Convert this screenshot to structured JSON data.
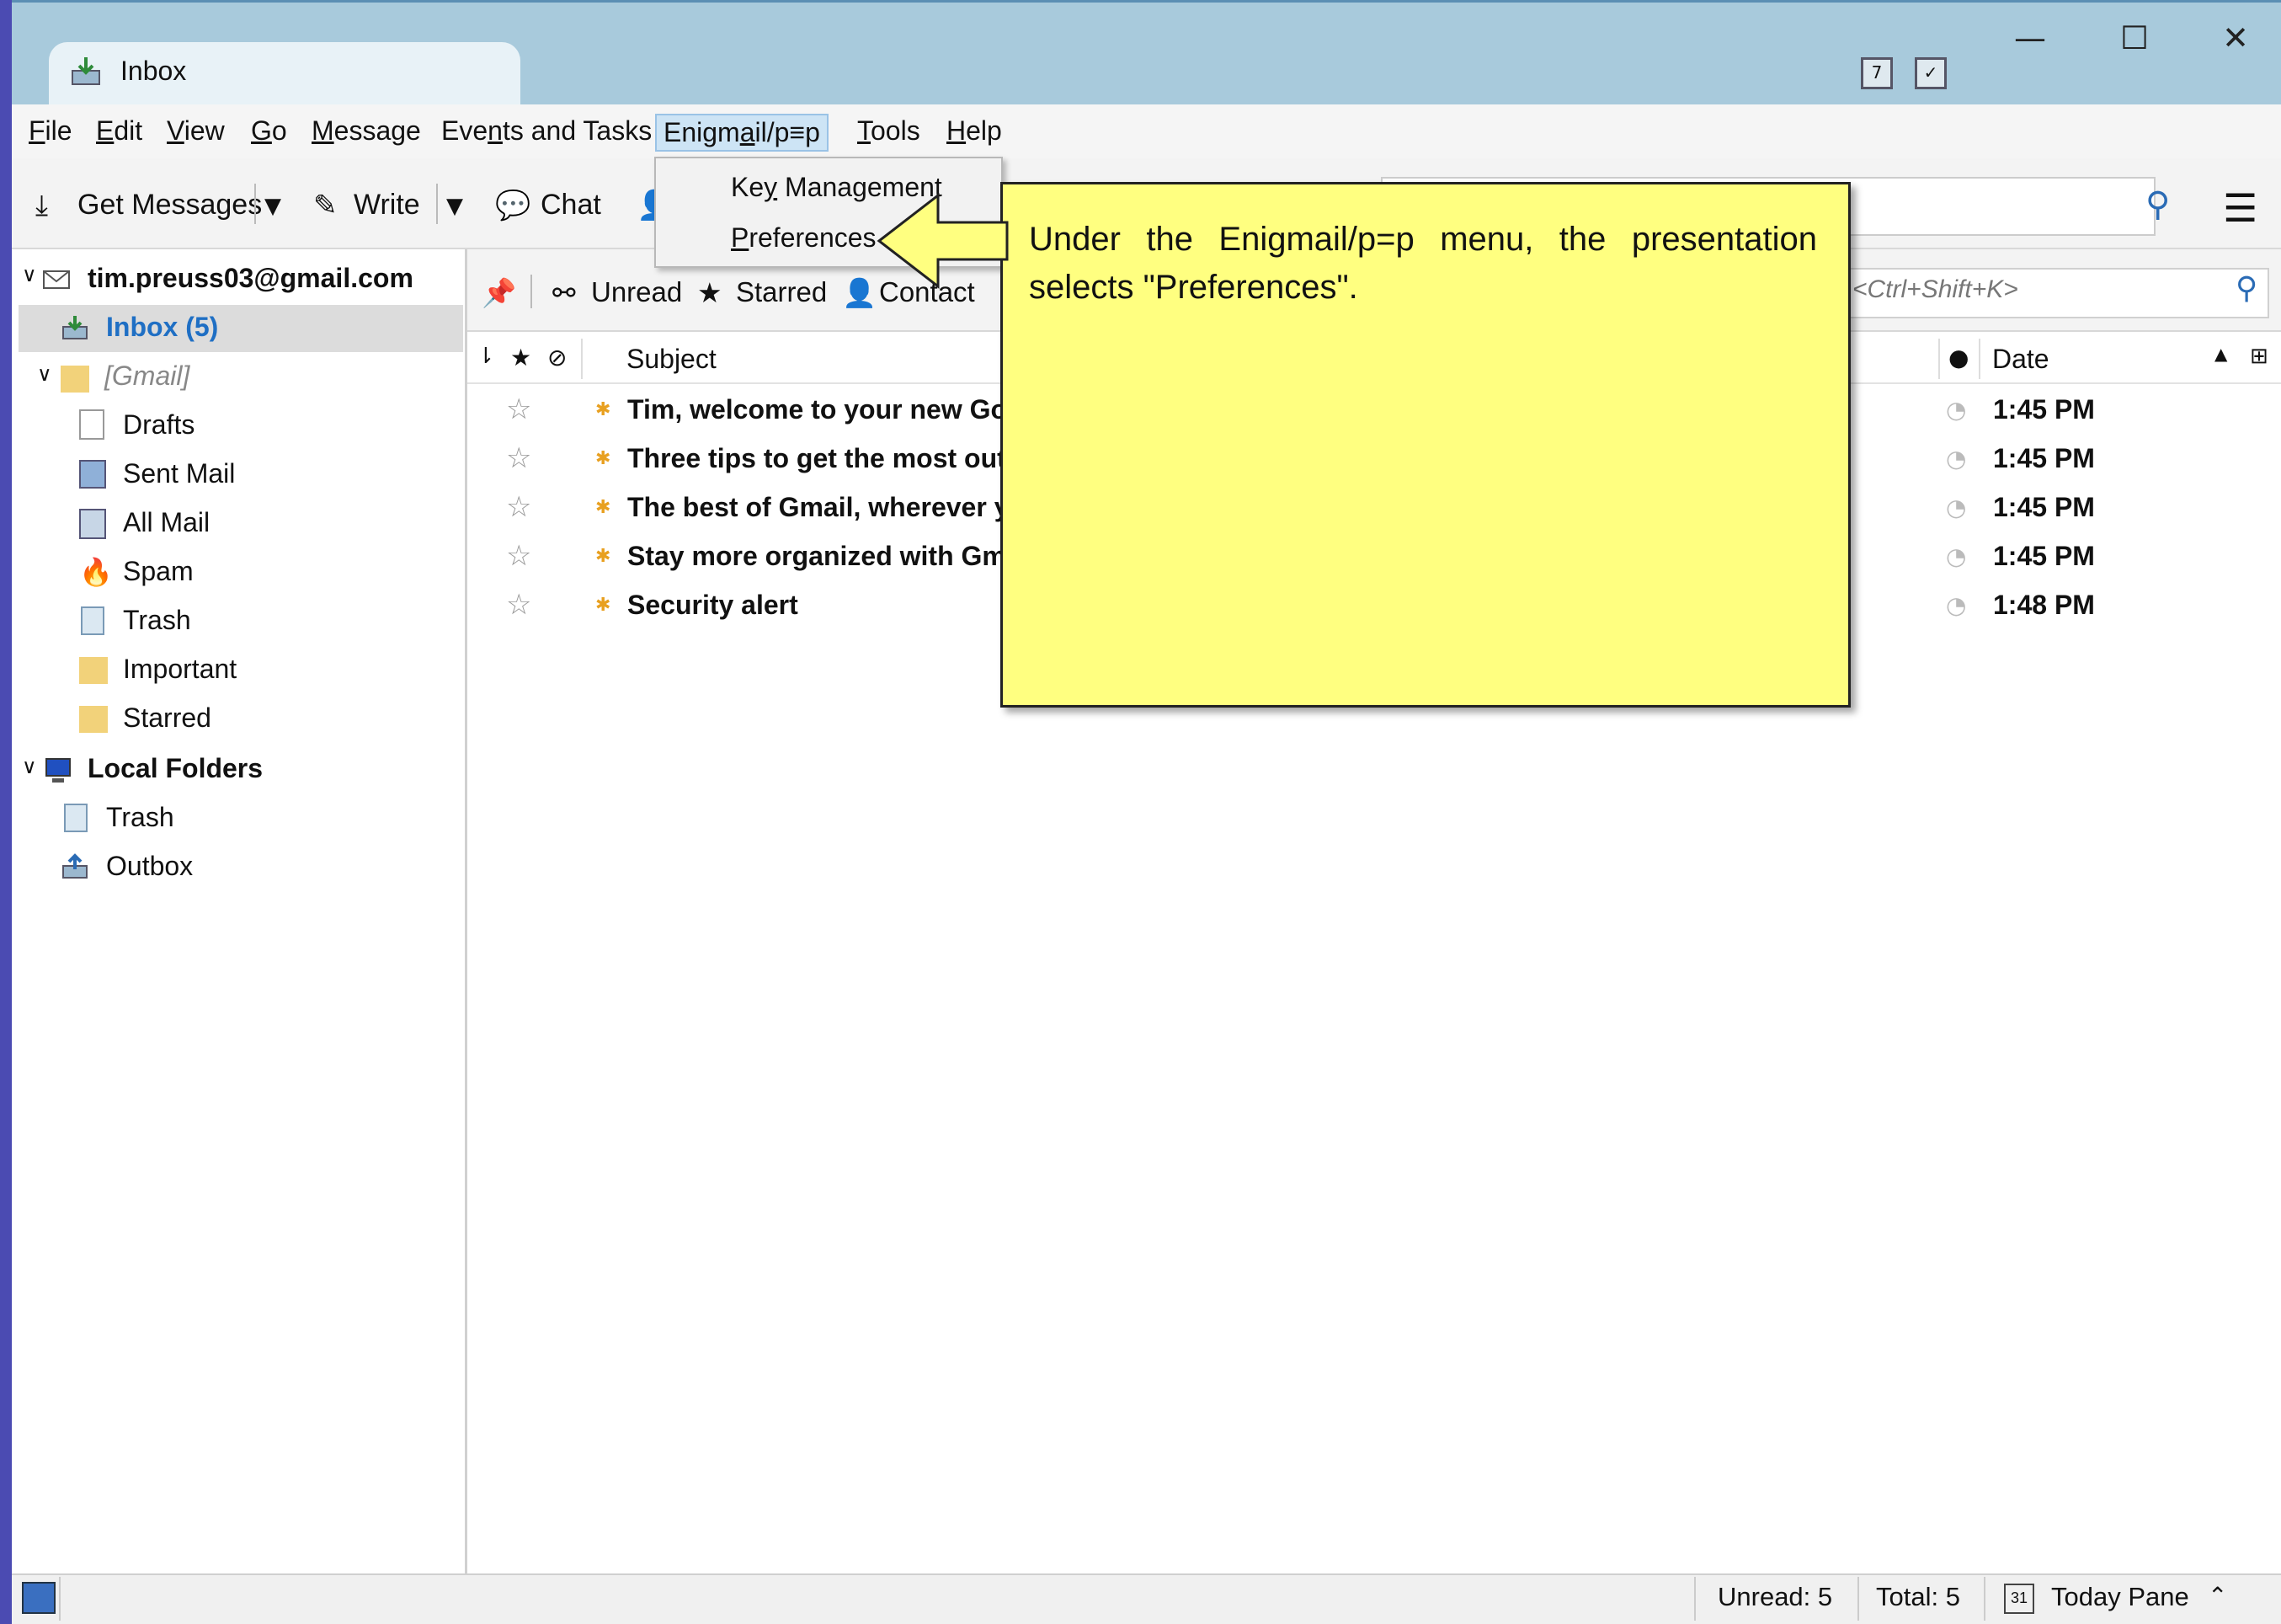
{
  "window": {
    "tab_title": "Inbox",
    "controls": {
      "minimize": "—",
      "maximize": "☐",
      "close": "✕"
    },
    "tb_icons": [
      "calendar-icon",
      "tasks-icon"
    ]
  },
  "menubar": {
    "items": [
      {
        "label": "File",
        "accel": "F",
        "rest": "ile"
      },
      {
        "label": "Edit",
        "accel": "E",
        "rest": "dit"
      },
      {
        "label": "View",
        "accel": "V",
        "rest": "iew"
      },
      {
        "label": "Go",
        "accel": "G",
        "rest": "o"
      },
      {
        "label": "Message",
        "accel": "M",
        "rest": "essage"
      },
      {
        "label": "Events and Tasks",
        "pre": "Eve",
        "accel": "n",
        "rest": "ts and Tasks"
      },
      {
        "label": "Enigmail/p≡p",
        "pre": "Enigm",
        "accel": "a",
        "rest": "il/p≡p"
      },
      {
        "label": "Tools",
        "accel": "T",
        "rest": "ools"
      },
      {
        "label": "Help",
        "accel": "H",
        "rest": "elp"
      }
    ]
  },
  "dropdown": {
    "items": [
      {
        "pre": "Ke",
        "accel": "y",
        "rest": " Management"
      },
      {
        "pre": "",
        "accel": "P",
        "rest": "references"
      }
    ]
  },
  "toolbar": {
    "get_messages": "Get Messages",
    "write": "Write",
    "chat": "Chat"
  },
  "folders": {
    "account": "tim.preuss03@gmail.com",
    "inbox": "Inbox (5)",
    "gmail": "[Gmail]",
    "drafts": "Drafts",
    "sent": "Sent Mail",
    "all": "All Mail",
    "spam": "Spam",
    "trash": "Trash",
    "important": "Important",
    "starred": "Starred",
    "local": "Local Folders",
    "local_trash": "Trash",
    "outbox": "Outbox"
  },
  "quickfilter": {
    "unread": "Unread",
    "starred": "Starred",
    "contact": "Contact",
    "search_placeholder": "<Ctrl+Shift+K>"
  },
  "thread_header": {
    "subject": "Subject",
    "date": "Date"
  },
  "messages": [
    {
      "subject": "Tim, welcome to your new Go",
      "date": "1:45 PM"
    },
    {
      "subject": "Three tips to get the most out",
      "date": "1:45 PM"
    },
    {
      "subject": "The best of Gmail, wherever y",
      "date": "1:45 PM"
    },
    {
      "subject": "Stay more organized with Gm",
      "date": "1:45 PM"
    },
    {
      "subject": "Security alert",
      "date": "1:48 PM"
    }
  ],
  "callout": {
    "text": "Under the Enigmail/p=p menu, the presentation selects \"Preferences\"."
  },
  "statusbar": {
    "unread": "Unread: 5",
    "total": "Total: 5",
    "today_pane": "Today Pane"
  },
  "colors": {
    "titlebar": "#a8cadc",
    "accent": "#2a6bb5",
    "callout": "#ffff80",
    "menu_highlight": "#cde4f5"
  }
}
